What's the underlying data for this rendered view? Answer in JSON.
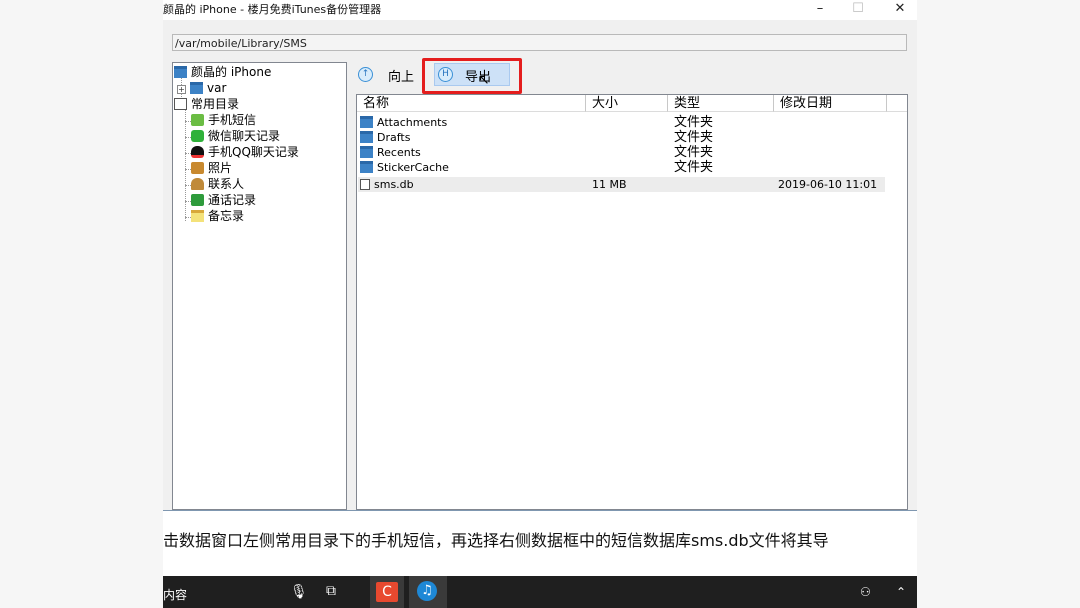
{
  "window": {
    "title": "颜晶的 iPhone - 楼月免费iTunes备份管理器",
    "controls": [
      "minimize-icon",
      "maximize-icon",
      "close-icon"
    ]
  },
  "path_bar": {
    "value": "/var/mobile/Library/SMS"
  },
  "tree": {
    "root": "颜晶的 iPhone",
    "var": "var",
    "common": "常用目录",
    "items": [
      {
        "label": "手机短信",
        "icon": "sms-icon"
      },
      {
        "label": "微信聊天记录",
        "icon": "wechat-icon"
      },
      {
        "label": "手机QQ聊天记录",
        "icon": "qq-icon"
      },
      {
        "label": "照片",
        "icon": "photo-icon"
      },
      {
        "label": "联系人",
        "icon": "contacts-icon"
      },
      {
        "label": "通话记录",
        "icon": "phone-icon"
      },
      {
        "label": "备忘录",
        "icon": "notes-icon"
      }
    ]
  },
  "toolbar": {
    "up_label": "向上",
    "export_label": "导出"
  },
  "file_list": {
    "columns": [
      "名称",
      "大小",
      "类型",
      "修改日期"
    ],
    "rows": [
      {
        "name": "Attachments",
        "size": "",
        "type": "文件夹",
        "date": "",
        "icon": "folder-icon"
      },
      {
        "name": "Drafts",
        "size": "",
        "type": "文件夹",
        "date": "",
        "icon": "folder-icon"
      },
      {
        "name": "Recents",
        "size": "",
        "type": "文件夹",
        "date": "",
        "icon": "folder-icon"
      },
      {
        "name": "StickerCache",
        "size": "",
        "type": "文件夹",
        "date": "",
        "icon": "folder-icon"
      },
      {
        "name": "sms.db",
        "size": "11 MB",
        "type": "",
        "date": "2019-06-10 11:01",
        "icon": "file-icon"
      }
    ]
  },
  "caption": "击数据窗口左侧常用目录下的手机短信，再选择右侧数据框中的短信数据库sms.db文件将其导",
  "taskbar": {
    "search_text": "内容"
  },
  "colors": {
    "highlight": "#e41d1d",
    "export_bg": "#cde1f7",
    "folder": "#3c82c6"
  }
}
